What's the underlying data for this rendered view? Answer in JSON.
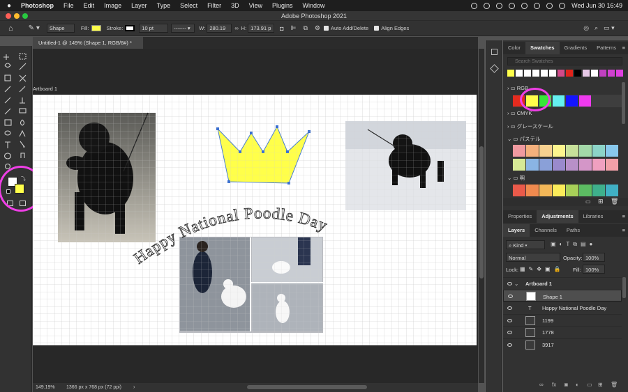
{
  "menubar": {
    "items": [
      "Photoshop",
      "File",
      "Edit",
      "Image",
      "Layer",
      "Type",
      "Select",
      "Filter",
      "3D",
      "View",
      "Plugins",
      "Window"
    ],
    "clock": "Wed Jun 30  16:49"
  },
  "window": {
    "title": "Adobe Photoshop 2021"
  },
  "options": {
    "mode": "Shape",
    "fill_label": "Fill:",
    "fill_color": "#ffff4a",
    "stroke_label": "Stroke:",
    "stroke_size": "10 pt",
    "w_label": "W:",
    "w_value": "280.19",
    "h_label": "H:",
    "h_value": "173.91 p",
    "auto_add_delete": "Auto Add/Delete",
    "align_edges": "Align Edges"
  },
  "document": {
    "tab_title": "Untitled-1 @ 149% (Shape 1, RGB/8#) *",
    "artboard_label": "Artboard 1",
    "curved_text": "Happy National Poodle Day",
    "zoom": "149.19%",
    "doc_info": "1366 px x 768 px (72 ppi)"
  },
  "swatches_panel": {
    "tabs": [
      "Color",
      "Swatches",
      "Gradients",
      "Patterns"
    ],
    "active_tab": "Swatches",
    "search_placeholder": "Search Swatches",
    "recent": [
      "#ffff4a",
      "#ffffff",
      "#ffffff",
      "#ffffff",
      "#ffffff",
      "#ffffff",
      "#d24a8a",
      "#e0231b",
      "#000000",
      "#e6c8e6",
      "#ffffff",
      "#c040c0",
      "#d040d0",
      "#e040e0"
    ],
    "groups": [
      {
        "name": "RGB",
        "swatches": [
          "#e52b1e",
          "#ffff4a",
          "#38e638",
          "#64f0f0",
          "#1414ff",
          "#ee3aee"
        ]
      },
      {
        "name": "CMYK",
        "swatches": []
      },
      {
        "name": "グレースケール",
        "swatches": []
      },
      {
        "name": "パステル",
        "swatches": [
          "#f09aa0",
          "#f4b07c",
          "#f7d190",
          "#fdf58e",
          "#c7e09a",
          "#a3d8a8",
          "#8cd4c8",
          "#88c8ec",
          "#d7ea96",
          "#8ab4e4",
          "#8aa0d8",
          "#9a8acc",
          "#b890c8",
          "#d496c8",
          "#f0a0c0",
          "#f1a0a8"
        ]
      },
      {
        "name": "明",
        "swatches": [
          "#ea5a4a",
          "#f08a4e",
          "#f3b758",
          "#fbec5a",
          "#a8d058",
          "#5cbc62",
          "#3eb08c",
          "#40b0c4"
        ]
      }
    ]
  },
  "adjustments_panel": {
    "tabs": [
      "Properties",
      "Adjustments",
      "Libraries"
    ],
    "active_tab": "Adjustments"
  },
  "layers_panel": {
    "tabs": [
      "Layers",
      "Channels",
      "Paths"
    ],
    "active_tab": "Layers",
    "filter_kind": "Kind",
    "blend_mode": "Normal",
    "opacity_label": "Opacity:",
    "opacity": "100%",
    "lock_label": "Lock:",
    "fill_label": "Fill:",
    "fill": "100%",
    "layers": [
      {
        "name": "Artboard 1",
        "type": "artboard"
      },
      {
        "name": "Shape 1",
        "type": "shape",
        "selected": true
      },
      {
        "name": "Happy National Poodle Day",
        "type": "text"
      },
      {
        "name": "1199",
        "type": "image"
      },
      {
        "name": "1778",
        "type": "image"
      },
      {
        "name": "3917",
        "type": "image"
      }
    ]
  },
  "colors": {
    "accent_highlight": "#ef3fe6",
    "foreground": "#ffffff",
    "background": "#ffff4a"
  }
}
